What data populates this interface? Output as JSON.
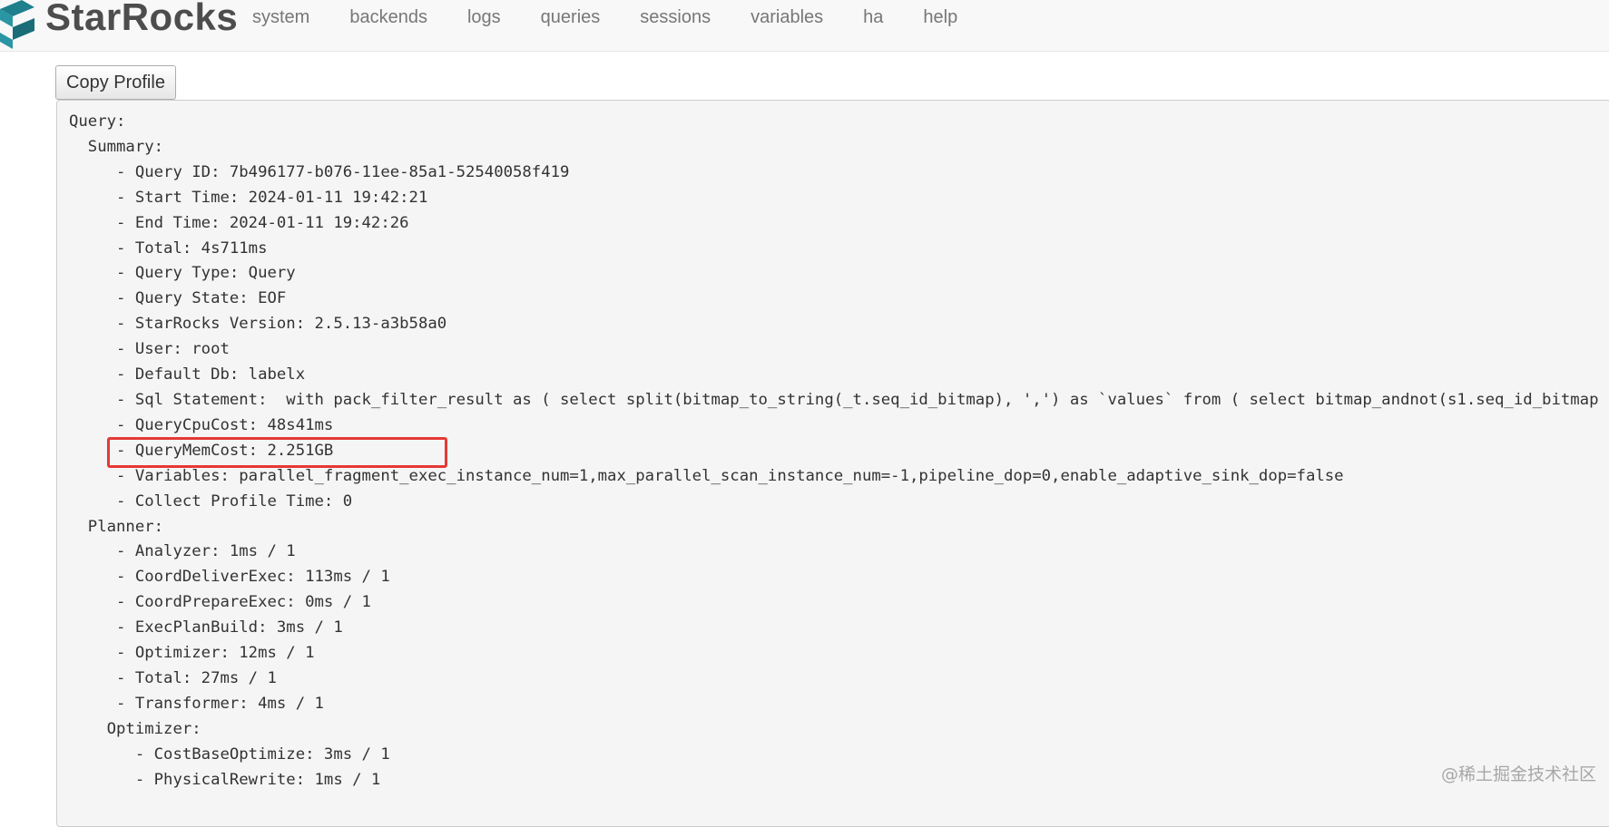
{
  "brand": {
    "name": "StarRocks"
  },
  "nav": {
    "items": [
      {
        "label": "system"
      },
      {
        "label": "backends"
      },
      {
        "label": "logs"
      },
      {
        "label": "queries"
      },
      {
        "label": "sessions"
      },
      {
        "label": "variables"
      },
      {
        "label": "ha"
      },
      {
        "label": "help"
      }
    ]
  },
  "toolbar": {
    "copy_label": "Copy Profile"
  },
  "profile": {
    "lines": [
      "Query:",
      "  Summary:",
      "     - Query ID: 7b496177-b076-11ee-85a1-52540058f419",
      "     - Start Time: 2024-01-11 19:42:21",
      "     - End Time: 2024-01-11 19:42:26",
      "     - Total: 4s711ms",
      "     - Query Type: Query",
      "     - Query State: EOF",
      "     - StarRocks Version: 2.5.13-a3b58a0",
      "     - User: root",
      "     - Default Db: labelx",
      "     - Sql Statement:  with pack_filter_result as ( select split(bitmap_to_string(_t.seq_id_bitmap), ',') as `values` from ( select bitmap_andnot(s1.seq_id_bitmap",
      "     - QueryCpuCost: 48s41ms",
      "     - QueryMemCost: 2.251GB",
      "     - Variables: parallel_fragment_exec_instance_num=1,max_parallel_scan_instance_num=-1,pipeline_dop=0,enable_adaptive_sink_dop=false",
      "     - Collect Profile Time: 0",
      "  Planner:",
      "     - Analyzer: 1ms / 1",
      "     - CoordDeliverExec: 113ms / 1",
      "     - CoordPrepareExec: 0ms / 1",
      "     - ExecPlanBuild: 3ms / 1",
      "     - Optimizer: 12ms / 1",
      "     - Total: 27ms / 1",
      "     - Transformer: 4ms / 1",
      "    Optimizer:",
      "       - CostBaseOptimize: 3ms / 1",
      "       - PhysicalRewrite: 1ms / 1"
    ]
  },
  "watermark": {
    "text": "@稀土掘金技术社区"
  },
  "colors": {
    "highlight": "#e53935",
    "navbar_bg": "#f8f8f8",
    "profile_bg": "#f5f5f5"
  }
}
